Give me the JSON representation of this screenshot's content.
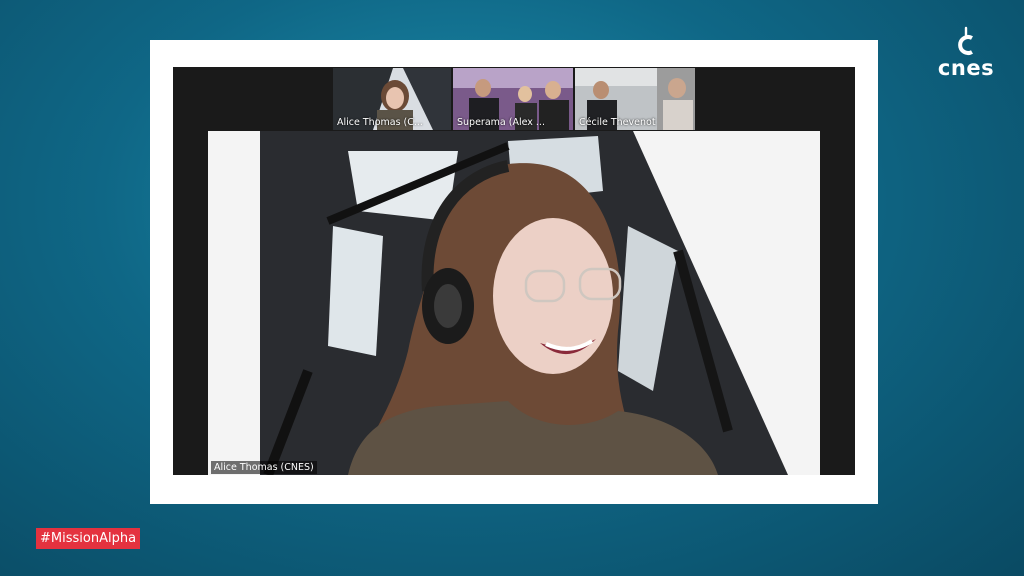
{
  "brand": {
    "logo_text": "cnes"
  },
  "participants": [
    {
      "name": "Alice Thomas (C..."
    },
    {
      "name": "Superama (Alex ..."
    },
    {
      "name": "Cécile Thevenot ..."
    },
    {
      "name": ""
    }
  ],
  "active_speaker": {
    "name": "Alice Thomas (CNES)"
  },
  "overlay": {
    "hashtag": "#MissionAlpha"
  },
  "colors": {
    "background": "#0f6786",
    "frame": "#ffffff",
    "hashtag_bg": "#e4323f",
    "meeting_bg": "#1a1a1a"
  }
}
